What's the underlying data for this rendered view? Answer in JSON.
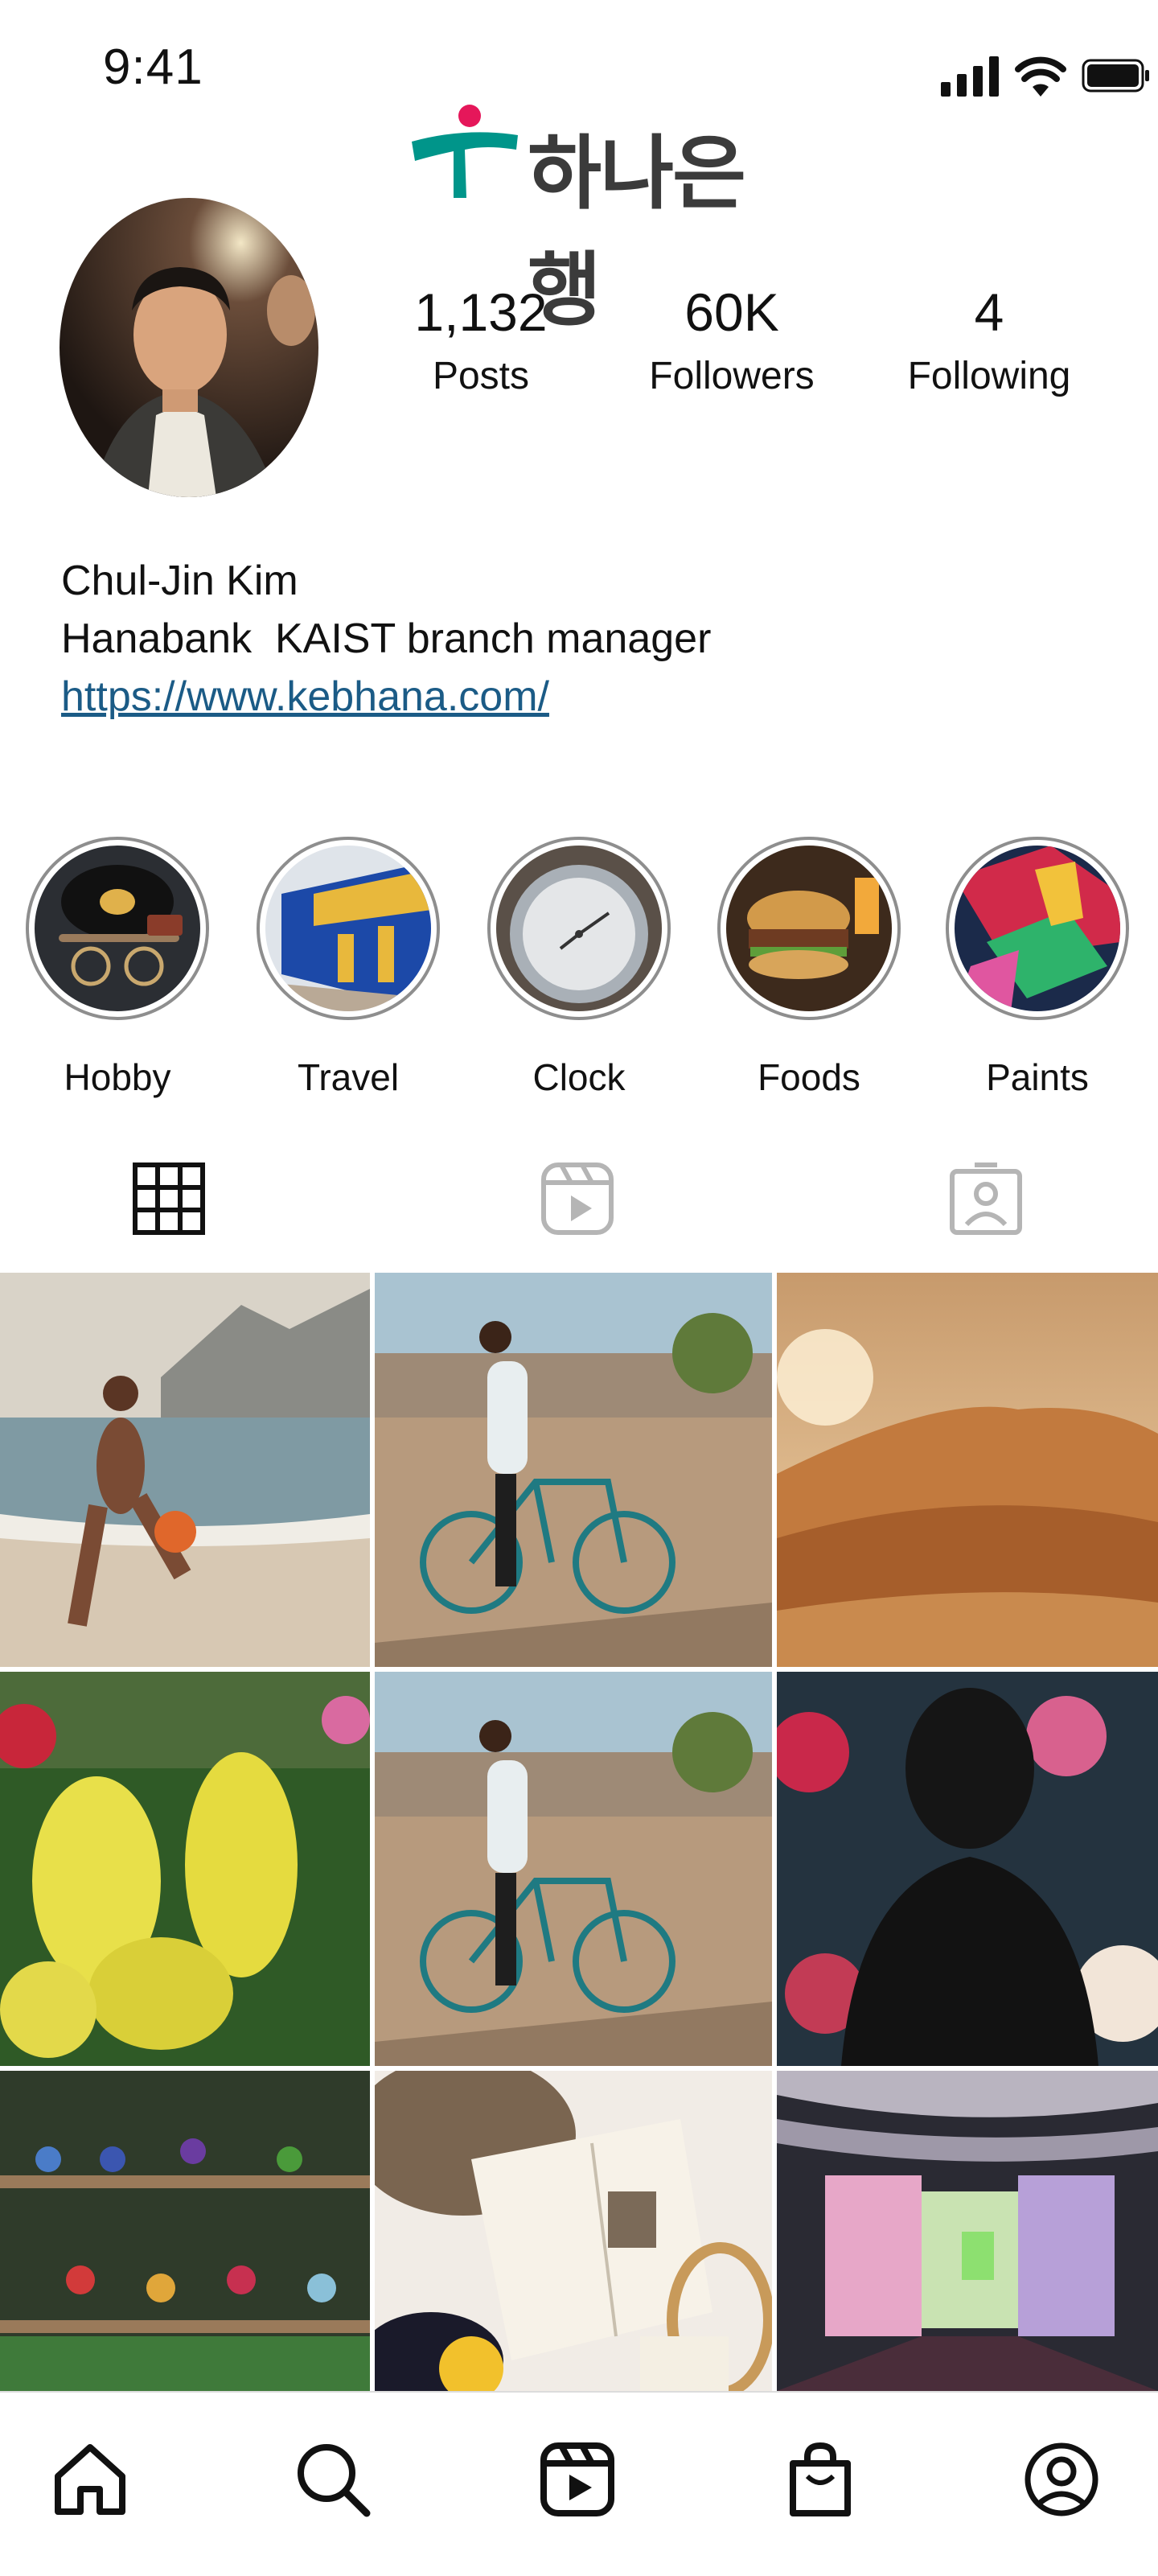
{
  "status_bar": {
    "time": "9:41",
    "icons": [
      "signal-icon",
      "wifi-icon",
      "battery-icon"
    ]
  },
  "brand": {
    "name": "하나은행",
    "accent_green": "#00958a",
    "accent_pink": "#e5175a"
  },
  "profile": {
    "stats": [
      {
        "value": "1,132",
        "label": "Posts"
      },
      {
        "value": "60K",
        "label": "Followers"
      },
      {
        "value": "4",
        "label": "Following"
      }
    ],
    "name": "Chul-Jin Kim",
    "bio": "Hanabank  KAIST branch manager",
    "link": "https://www.kebhana.com/"
  },
  "highlights": [
    {
      "label": "Hobby"
    },
    {
      "label": "Travel"
    },
    {
      "label": "Clock"
    },
    {
      "label": "Foods"
    },
    {
      "label": "Paints"
    }
  ],
  "tabs": [
    {
      "icon": "grid-icon",
      "active": true
    },
    {
      "icon": "reels-icon",
      "active": false
    },
    {
      "icon": "tagged-icon",
      "active": false
    }
  ],
  "nav": [
    "home-icon",
    "search-icon",
    "reels-icon",
    "shop-icon",
    "profile-icon"
  ],
  "colors": {
    "link": "#1b5b86",
    "ring": "#8e8e8e",
    "inactive_icon": "#b5b5b5"
  }
}
